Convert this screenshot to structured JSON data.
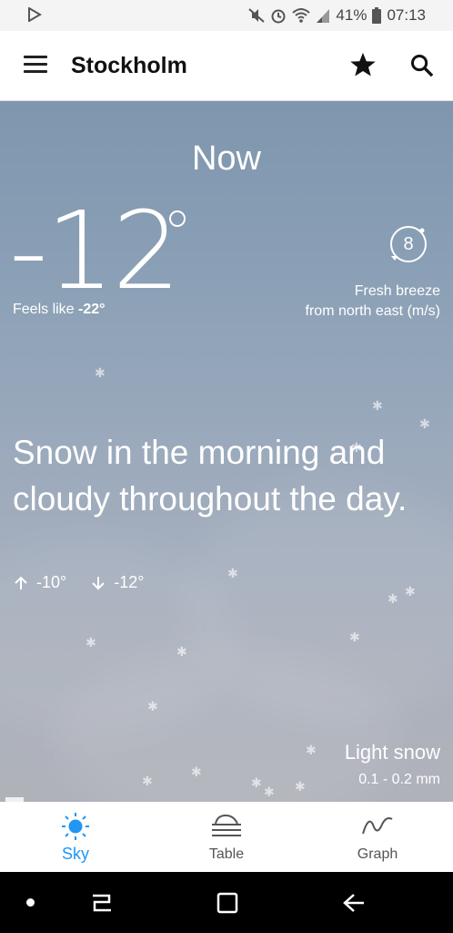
{
  "status_bar": {
    "battery_percent": "41%",
    "time": "07:13",
    "icons": [
      "play-store-icon",
      "mute-icon",
      "alarm-icon",
      "wifi-icon",
      "signal-icon",
      "battery-icon"
    ]
  },
  "app_bar": {
    "title": "Stockholm",
    "icons": [
      "menu-icon",
      "star-icon",
      "search-icon"
    ]
  },
  "now": {
    "label": "Now",
    "temperature": "-12",
    "feels_like_prefix": "Feels like",
    "feels_like_value": "-22°",
    "wind_speed": "8",
    "wind_desc_line1": "Fresh breeze",
    "wind_desc_line2": "from north east (m/s)",
    "summary": "Snow in the morning and cloudy throughout the day.",
    "high": "-10°",
    "low": "-12°",
    "precip_type": "Light snow",
    "precip_amount": "0.1 - 0.2 mm"
  },
  "tabs": [
    {
      "label": "Sky",
      "icon": "sun-icon",
      "active": true
    },
    {
      "label": "Table",
      "icon": "table-icon",
      "active": false
    },
    {
      "label": "Graph",
      "icon": "graph-icon",
      "active": false
    }
  ],
  "colors": {
    "accent": "#2196f3",
    "sky_top": "#7e96ae",
    "sky_bottom": "#b0b2ba"
  }
}
